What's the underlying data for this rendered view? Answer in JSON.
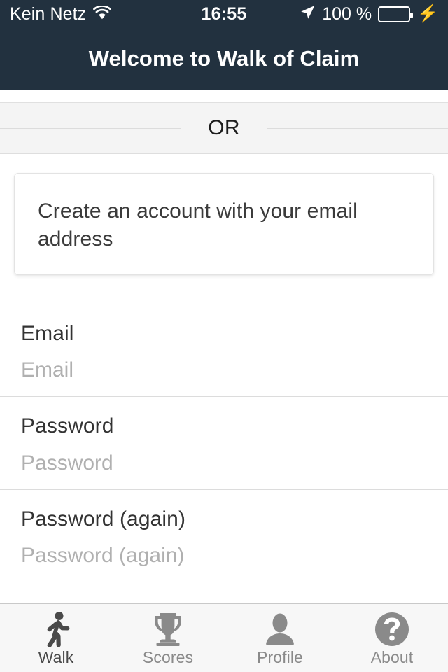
{
  "status_bar": {
    "carrier": "Kein Netz",
    "wifi_icon": "wifi-icon",
    "time": "16:55",
    "location_icon": "location-arrow-icon",
    "battery_percent": "100 %",
    "battery_icon": "battery-full-icon",
    "charging_icon": "lightning-bolt-icon",
    "battery_color": "#4cd964"
  },
  "navbar": {
    "title": "Welcome to Walk of Claim",
    "background_color": "#22313f"
  },
  "divider": {
    "label": "OR"
  },
  "card": {
    "text": "Create an account with your email address"
  },
  "form": {
    "fields": [
      {
        "label": "Email",
        "value": "",
        "placeholder": "Email"
      },
      {
        "label": "Password",
        "value": "",
        "placeholder": "Password"
      },
      {
        "label": "Password (again)",
        "value": "",
        "placeholder": "Password (again)"
      }
    ]
  },
  "tabbar": {
    "items": [
      {
        "label": "Walk",
        "icon": "walking-person-icon",
        "active": true
      },
      {
        "label": "Scores",
        "icon": "trophy-icon",
        "active": false
      },
      {
        "label": "Profile",
        "icon": "person-silhouette-icon",
        "active": false
      },
      {
        "label": "About",
        "icon": "question-mark-circle-icon",
        "active": false
      }
    ],
    "active_color": "#4a4a4a",
    "inactive_color": "#8a8a8a"
  }
}
